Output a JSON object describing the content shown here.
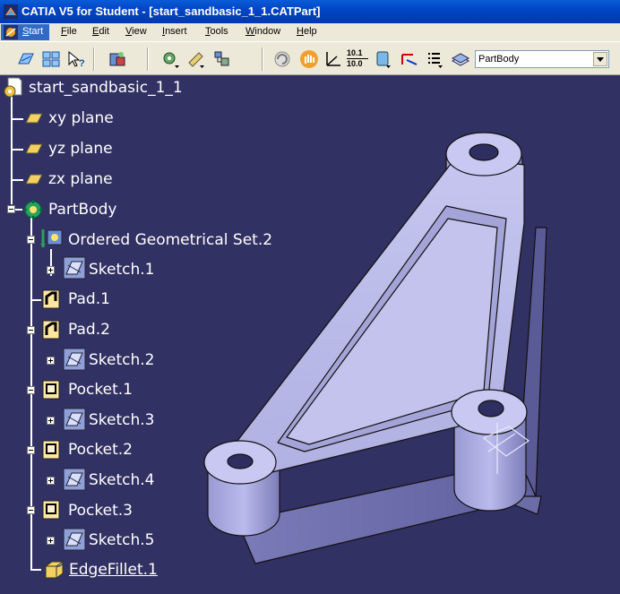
{
  "window": {
    "title": "CATIA V5 for Student - [start_sandbasic_1_1.CATPart]"
  },
  "menu": {
    "items": [
      {
        "label": "Start",
        "accel": "S",
        "rest": "tart"
      },
      {
        "label": "File",
        "accel": "F",
        "rest": "ile"
      },
      {
        "label": "Edit",
        "accel": "E",
        "rest": "dit"
      },
      {
        "label": "View",
        "accel": "V",
        "rest": "iew"
      },
      {
        "label": "Insert",
        "accel": "I",
        "rest": "nsert"
      },
      {
        "label": "Tools",
        "accel": "T",
        "rest": "ools"
      },
      {
        "label": "Window",
        "accel": "W",
        "rest": "indow"
      },
      {
        "label": "Help",
        "accel": "H",
        "rest": "elp"
      }
    ]
  },
  "toolbar": {
    "icons": [
      "sketch-icon",
      "multi-view-icon",
      "whats-this-icon",
      "catalog-icon",
      "analysis-icon",
      "measure-icon",
      "tools-icon",
      "refresh-icon",
      "hand-icon",
      "axis-icon",
      "grid-numbers-icon",
      "spec-icon",
      "swap-icon",
      "list-icon",
      "layer-icon"
    ],
    "grid_numbers": [
      "10.1",
      "10.0"
    ],
    "body_select": "PartBody"
  },
  "tree": {
    "root": "start_sandbasic_1_1",
    "planes": [
      "xy plane",
      "yz plane",
      "zx plane"
    ],
    "partbody": "PartBody",
    "geom_set": "Ordered Geometrical Set.2",
    "sketch1": "Sketch.1",
    "pad1": "Pad.1",
    "pad2": "Pad.2",
    "sketch2": "Sketch.2",
    "pocket1": "Pocket.1",
    "sketch3": "Sketch.3",
    "pocket2": "Pocket.2",
    "sketch4": "Sketch.4",
    "pocket3": "Pocket.3",
    "sketch5": "Sketch.5",
    "edgefillet": "EdgeFillet.1"
  }
}
